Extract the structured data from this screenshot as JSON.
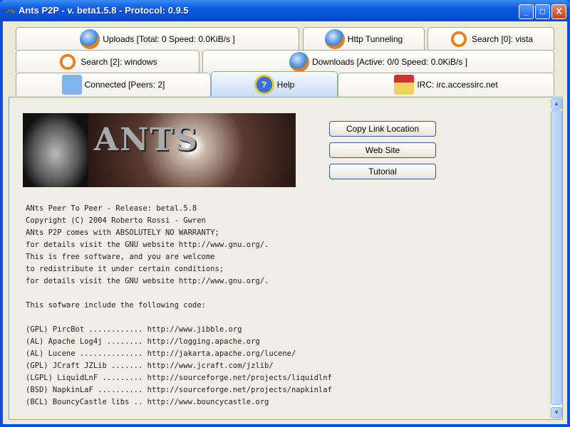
{
  "window": {
    "title": "Ants P2P - v. beta1.5.8 - Protocol: 0.9.5",
    "minimize": "_",
    "maximize": "□",
    "close": "X"
  },
  "tabs": [
    {
      "label": "Uploads [Total: 0 Speed: 0.0KiB/s ]",
      "icon": "globe-upload-icon"
    },
    {
      "label": "Http Tunneling",
      "icon": "globe-search-icon"
    },
    {
      "label": "Search [0]: vista",
      "icon": "magnifier-icon"
    },
    {
      "label": "Search [2]: windows",
      "icon": "magnifier-icon"
    },
    {
      "label": "Downloads [Active: 0/0 Speed: 0.0KiB/s ]",
      "icon": "globe-download-icon"
    },
    {
      "label": "Connected [Peers: 2]",
      "icon": "monitor-icon"
    },
    {
      "label": "Help",
      "icon": "help-icon",
      "selected": true
    },
    {
      "label": "IRC: irc.accessirc.net",
      "icon": "irc-folder-icon"
    }
  ],
  "help": {
    "logo_text": "ANTS",
    "buttons": [
      "Copy Link Location",
      "Web Site",
      "Tutorial"
    ],
    "lines": [
      "ANts Peer To Peer - Release: betal.5.8",
      "Copyright (C) 2004 Roberto Rossi - Gwren",
      "ANts P2P comes with ABSOLUTELY NO WARRANTY;",
      "for details visit the GNU website http://www.gnu.org/.",
      "This is free software, and you are welcome",
      "to redistribute it under certain conditions;",
      "for details visit the GNU website http://www.gnu.org/.",
      "",
      "This sofware include the following code:",
      "",
      "(GPL) PircBot ............ http://www.jibble.org",
      "(AL) Apache Log4j ........ http://logging.apache.org",
      "(AL) Lucene .............. http://jakarta.apache.org/lucene/",
      "(GPL) JCraft JZLib ....... http://www.jcraft.com/jzlib/",
      "(LGPL) LiquidLnF ......... http://sourceforge.net/projects/liquidlnf",
      "(BSD) NapkinLaF .......... http://sourceforge.net/projects/napkinlaf",
      "(BCL) BouncyCastle libs .. http://www.bouncycastle.org"
    ]
  }
}
